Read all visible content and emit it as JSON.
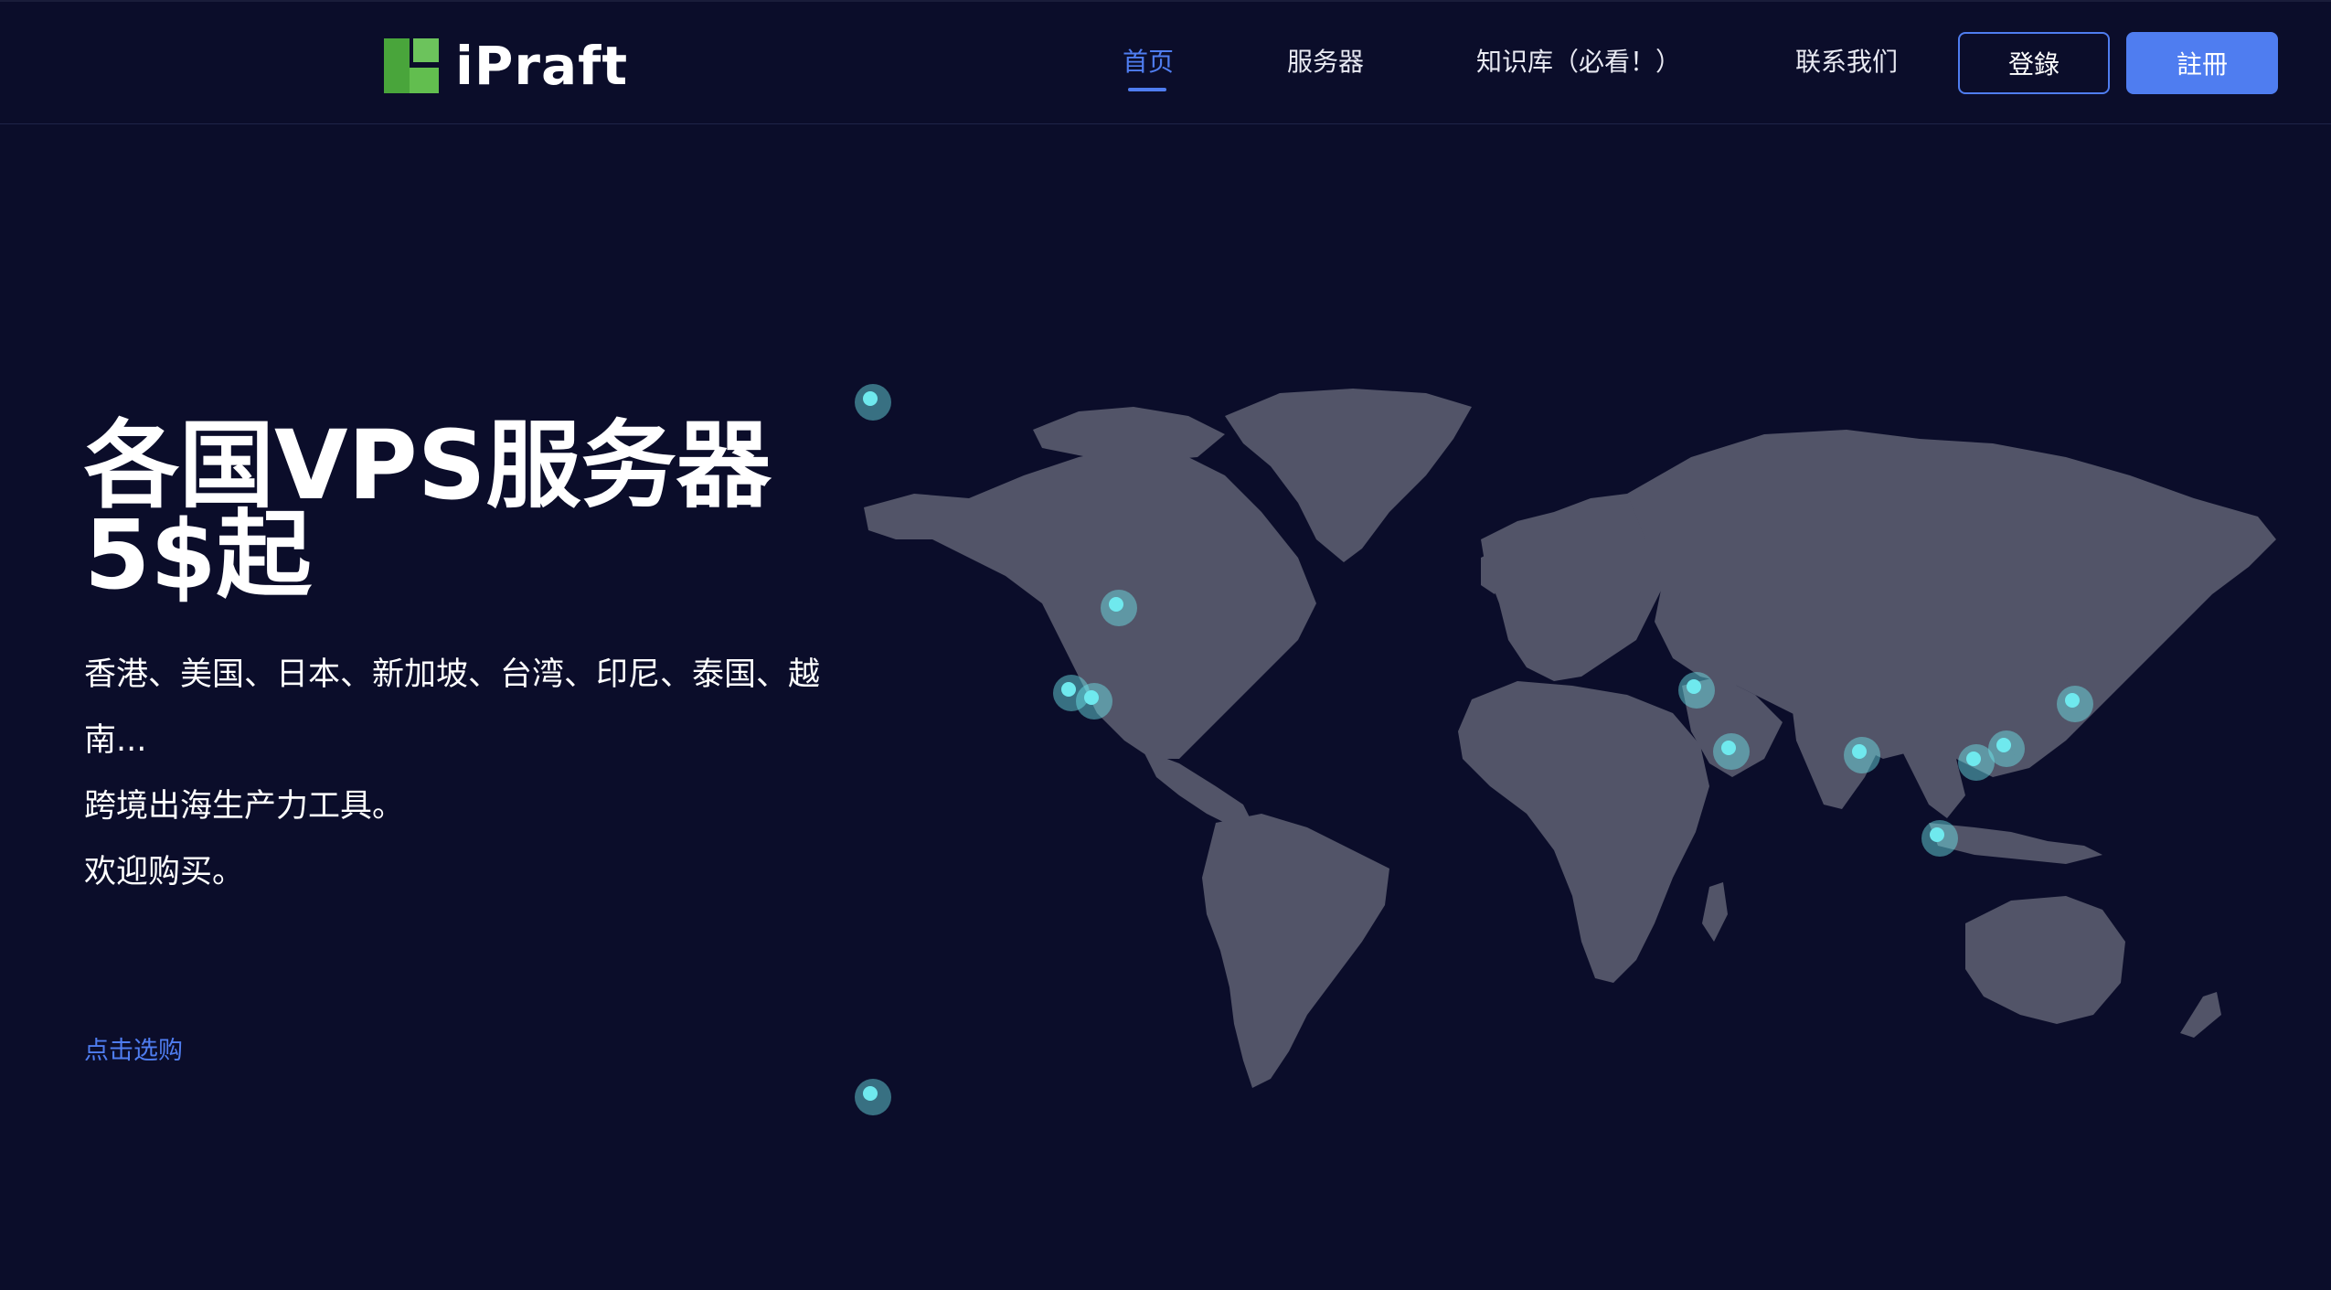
{
  "header": {
    "logo_text": "iPraft",
    "nav": [
      {
        "label": "首页",
        "active": true
      },
      {
        "label": "服务器",
        "active": false
      },
      {
        "label": "知识库（必看！）",
        "active": false
      },
      {
        "label": "联系我们",
        "active": false
      }
    ],
    "login_label": "登錄",
    "register_label": "註冊"
  },
  "hero": {
    "title_line1": "各国VPS服务器",
    "title_line2": "5$起",
    "desc_line1": "香港、美国、日本、新加坡、台湾、印尼、泰国、越",
    "desc_line2": "南...",
    "desc_line3": "跨境出海生产力工具。",
    "desc_line4": "欢迎购买。",
    "cta_label": "点击选购"
  },
  "map": {
    "land_color": "#525468",
    "marker_color": "#6fe9ee"
  },
  "colors": {
    "background": "#0b0d2a",
    "accent": "#4f7df0",
    "logo_green": "#49a53b"
  }
}
